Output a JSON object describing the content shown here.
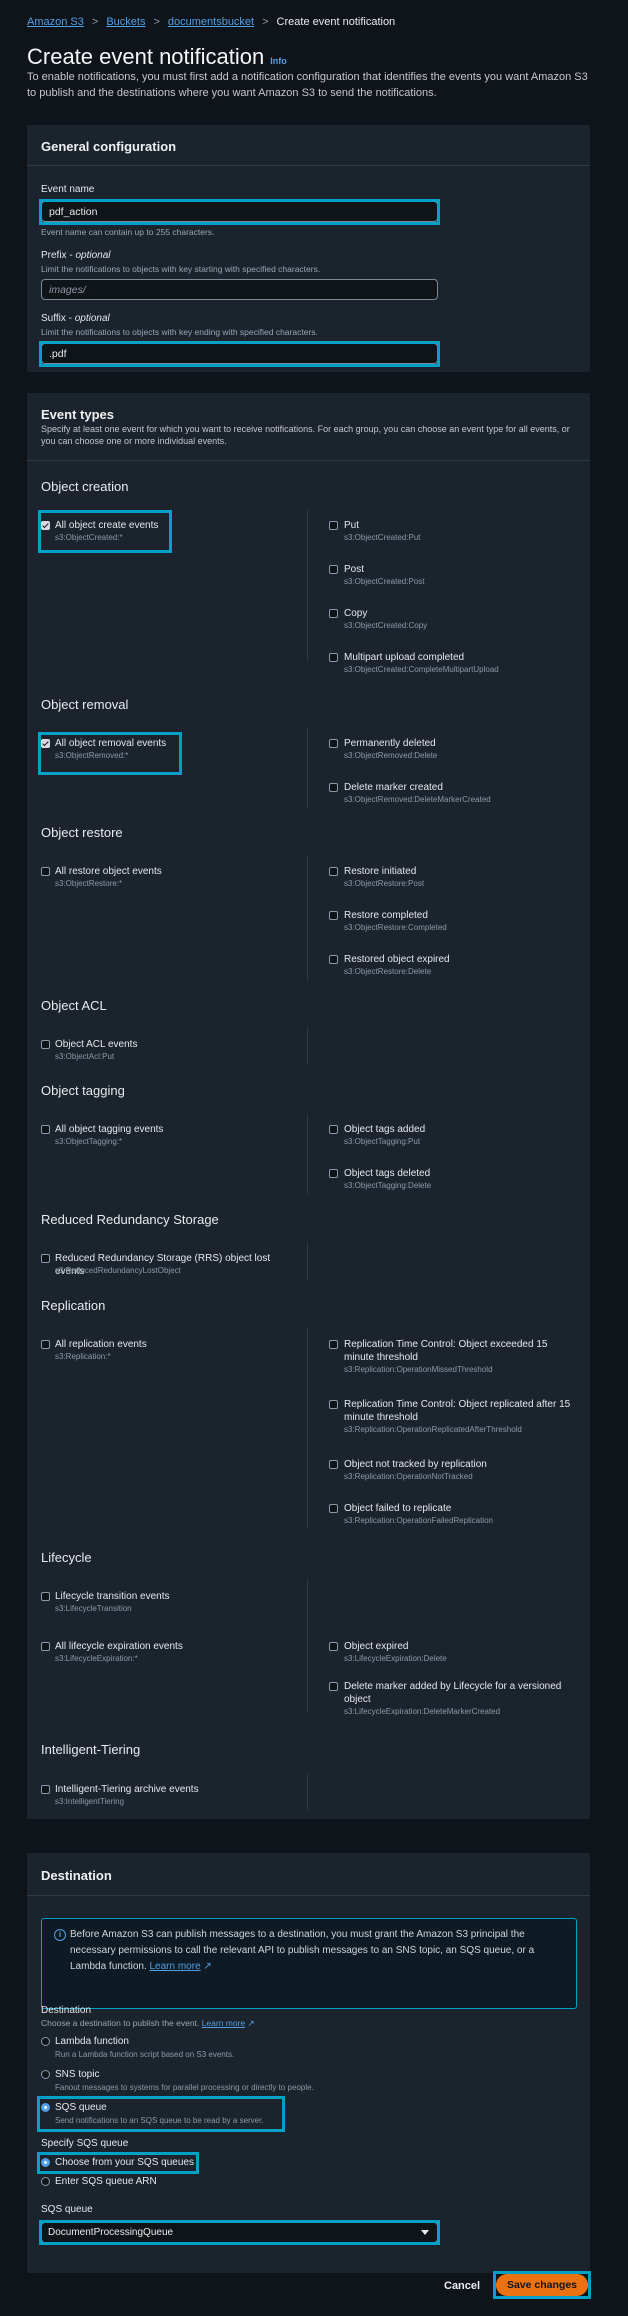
{
  "breadcrumb": {
    "items": [
      "Amazon S3",
      "Buckets",
      "documentsbucket"
    ],
    "current": "Create event notification"
  },
  "page": {
    "title": "Create event notification",
    "info": "Info",
    "intro": "To enable notifications, you must first add a notification configuration that identifies the events you want Amazon S3 to publish and the destinations where you want Amazon S3 to send the notifications."
  },
  "general": {
    "heading": "General configuration",
    "event_name_label": "Event name",
    "event_name_value": "pdf_action",
    "event_name_hint": "Event name can contain up to 255 characters.",
    "prefix_label": "Prefix",
    "prefix_optional": "optional",
    "prefix_hint": "Limit the notifications to objects with key starting with specified characters.",
    "prefix_placeholder": "images/",
    "suffix_label": "Suffix",
    "suffix_optional": "optional",
    "suffix_hint": "Limit the notifications to objects with key ending with specified characters.",
    "suffix_value": ".pdf"
  },
  "event_types": {
    "heading": "Event types",
    "description": "Specify at least one event for which you want to receive notifications. For each group, you can choose an event type for all events, or you can choose one or more individual events.",
    "groups": [
      {
        "title": "Object creation",
        "left": [
          {
            "label": "All object create events",
            "api": "s3:ObjectCreated:*",
            "checked": true
          }
        ],
        "right": [
          {
            "label": "Put",
            "api": "s3:ObjectCreated:Put"
          },
          {
            "label": "Post",
            "api": "s3:ObjectCreated:Post"
          },
          {
            "label": "Copy",
            "api": "s3:ObjectCreated:Copy"
          },
          {
            "label": "Multipart upload completed",
            "api": "s3:ObjectCreated:CompleteMultipartUpload"
          }
        ]
      },
      {
        "title": "Object removal",
        "left": [
          {
            "label": "All object removal events",
            "api": "s3:ObjectRemoved:*",
            "checked": true
          }
        ],
        "right": [
          {
            "label": "Permanently deleted",
            "api": "s3:ObjectRemoved:Delete"
          },
          {
            "label": "Delete marker created",
            "api": "s3:ObjectRemoved:DeleteMarkerCreated"
          }
        ]
      },
      {
        "title": "Object restore",
        "left": [
          {
            "label": "All restore object events",
            "api": "s3:ObjectRestore:*"
          }
        ],
        "right": [
          {
            "label": "Restore initiated",
            "api": "s3:ObjectRestore:Post"
          },
          {
            "label": "Restore completed",
            "api": "s3:ObjectRestore:Completed"
          },
          {
            "label": "Restored object expired",
            "api": "s3:ObjectRestore:Delete"
          }
        ]
      },
      {
        "title": "Object ACL",
        "left": [
          {
            "label": "Object ACL events",
            "api": "s3:ObjectAcl:Put"
          }
        ],
        "right": []
      },
      {
        "title": "Object tagging",
        "left": [
          {
            "label": "All object tagging events",
            "api": "s3:ObjectTagging:*"
          }
        ],
        "right": [
          {
            "label": "Object tags added",
            "api": "s3:ObjectTagging:Put"
          },
          {
            "label": "Object tags deleted",
            "api": "s3:ObjectTagging:Delete"
          }
        ]
      },
      {
        "title": "Reduced Redundancy Storage",
        "left": [
          {
            "label": "Reduced Redundancy Storage (RRS) object lost events",
            "api": "s3:ReducedRedundancyLostObject"
          }
        ],
        "right": []
      },
      {
        "title": "Replication",
        "left": [
          {
            "label": "All replication events",
            "api": "s3:Replication:*"
          }
        ],
        "right": [
          {
            "label": "Replication Time Control: Object exceeded 15 minute threshold",
            "api": "s3:Replication:OperationMissedThreshold"
          },
          {
            "label": "Replication Time Control: Object replicated after 15 minute threshold",
            "api": "s3:Replication:OperationReplicatedAfterThreshold"
          },
          {
            "label": "Object not tracked by replication",
            "api": "s3:Replication:OperationNotTracked"
          },
          {
            "label": "Object failed to replicate",
            "api": "s3:Replication:OperationFailedReplication"
          }
        ]
      },
      {
        "title": "Lifecycle",
        "left": [
          {
            "label": "Lifecycle transition events",
            "api": "s3:LifecycleTransition"
          },
          {
            "label": "All lifecycle expiration events",
            "api": "s3:LifecycleExpiration:*"
          }
        ],
        "right": [
          {
            "label": "Object expired",
            "api": "s3:LifecycleExpiration:Delete"
          },
          {
            "label": "Delete marker added by Lifecycle for a versioned object",
            "api": "s3:LifecycleExpiration:DeleteMarkerCreated"
          }
        ]
      },
      {
        "title": "Intelligent-Tiering",
        "left": [
          {
            "label": "Intelligent-Tiering archive events",
            "api": "s3:IntelligentTiering"
          }
        ],
        "right": []
      }
    ]
  },
  "destination": {
    "heading": "Destination",
    "alert_text": "Before Amazon S3 can publish messages to a destination, you must grant the Amazon S3 principal the necessary permissions to call the relevant API to publish messages to an SNS topic, an SQS queue, or a Lambda function.",
    "alert_link": "Learn more",
    "dest_label": "Destination",
    "dest_hint": "Choose a destination to publish the event.",
    "dest_hint_link": "Learn more",
    "options": [
      {
        "label": "Lambda function",
        "desc": "Run a Lambda function script based on S3 events."
      },
      {
        "label": "SNS topic",
        "desc": "Fanout messages to systems for parallel processing or directly to people."
      },
      {
        "label": "SQS queue",
        "desc": "Send notifications to an SQS queue to be read by a server."
      }
    ],
    "selected_option": "SQS queue",
    "specify_label": "Specify SQS queue",
    "specify_options": [
      "Choose from your SQS queues",
      "Enter SQS queue ARN"
    ],
    "queue_label": "SQS queue",
    "queue_value": "DocumentProcessingQueue"
  },
  "footer": {
    "cancel": "Cancel",
    "save": "Save changes"
  },
  "colors": {
    "accent_link": "#539fe5",
    "highlight": "#00a1c9",
    "primary_button": "#ec7211",
    "background": "#0f141a",
    "panel": "#1b232d"
  }
}
